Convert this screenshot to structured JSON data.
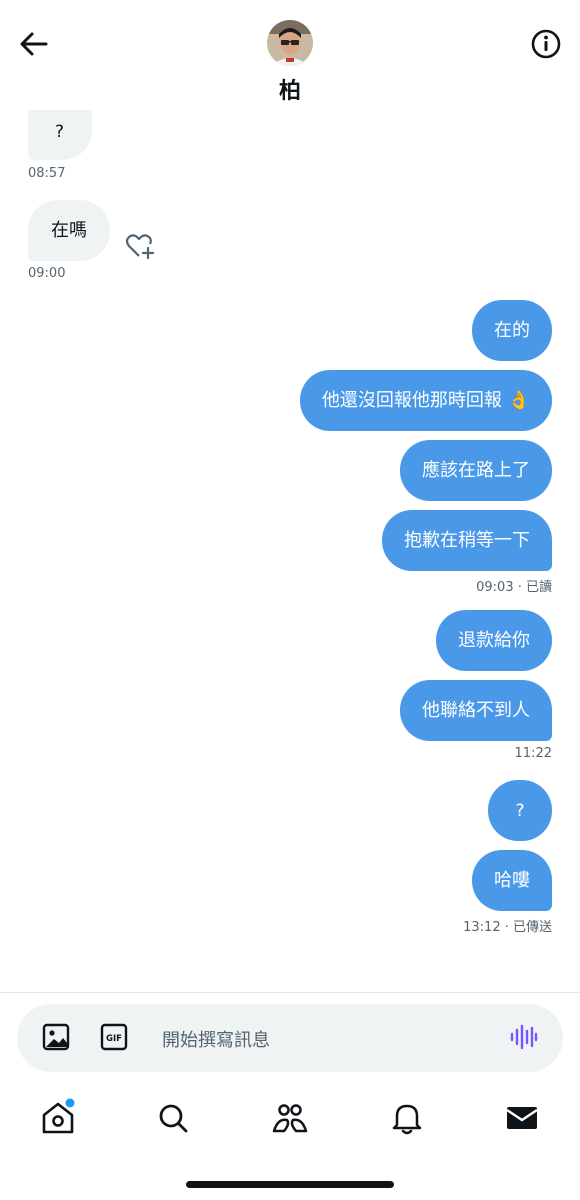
{
  "header": {
    "contact_name": "柏"
  },
  "messages": [
    {
      "side": "received",
      "text": "?",
      "time": "08:57"
    },
    {
      "side": "received",
      "text": "在嗎",
      "time": "09:00"
    },
    {
      "side": "sent",
      "text": "在的"
    },
    {
      "side": "sent",
      "text": "他還沒回報他那時回報 👌"
    },
    {
      "side": "sent",
      "text": "應該在路上了"
    },
    {
      "side": "sent",
      "text": "抱歉在稍等一下",
      "status": "09:03 · 已讀"
    },
    {
      "side": "sent",
      "text": "退款給你"
    },
    {
      "side": "sent",
      "text": "他聯絡不到人",
      "status": "11:22"
    },
    {
      "side": "sent",
      "text": "?"
    },
    {
      "side": "sent",
      "text": "哈嘍",
      "status": "13:12 · 已傳送"
    }
  ],
  "composer": {
    "placeholder": "開始撰寫訊息",
    "gif_label": "GIF"
  },
  "tabs": [
    {
      "name": "home",
      "icon": "home-icon",
      "has_notification_dot": true
    },
    {
      "name": "search",
      "icon": "search-icon"
    },
    {
      "name": "communities",
      "icon": "communities-icon"
    },
    {
      "name": "notifications",
      "icon": "bell-icon"
    },
    {
      "name": "messages",
      "icon": "envelope-icon",
      "active": true
    }
  ],
  "colors": {
    "sent_bubble": "#4a99e9",
    "received_bubble": "#eff3f4",
    "accent": "#1d9bf0",
    "voice_icon": "#7856ff"
  }
}
